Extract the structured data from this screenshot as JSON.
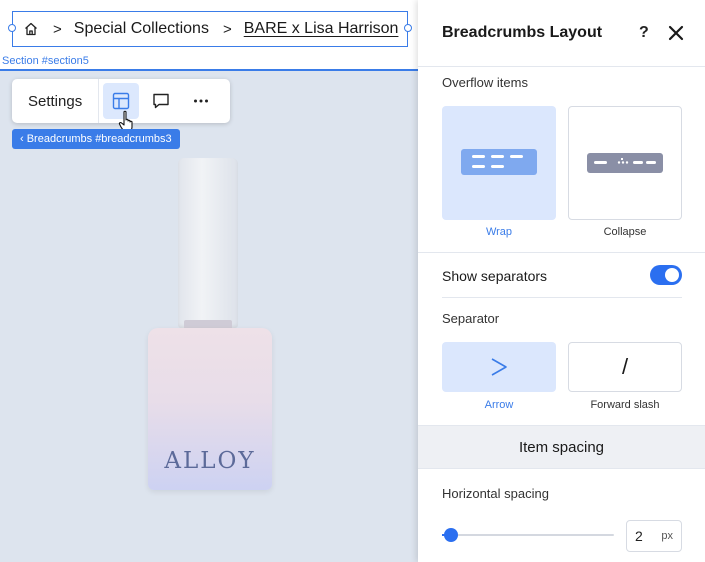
{
  "canvas": {
    "section_label": "Section #section5",
    "breadcrumbs": {
      "separator": ">",
      "items": [
        "Special Collections",
        "BARE x Lisa Harrison"
      ],
      "home_icon": "home-icon"
    },
    "toolbar": {
      "settings_label": "Settings",
      "layout_icon": "layout-icon",
      "comment_icon": "comment-icon",
      "more_icon": "more-horizontal-icon"
    },
    "element_chip": "‹ Breadcrumbs #breadcrumbs3",
    "product_brand": "ALLOY"
  },
  "panel": {
    "title": "Breadcrumbs Layout",
    "help": "?",
    "overflow_items": {
      "label": "Overflow items",
      "options": [
        {
          "label": "Wrap",
          "selected": true
        },
        {
          "label": "Collapse",
          "selected": false
        }
      ]
    },
    "show_separators": {
      "label": "Show separators",
      "on": true
    },
    "separator": {
      "label": "Separator",
      "options": [
        {
          "label": "Arrow",
          "glyph": ">",
          "selected": true
        },
        {
          "label": "Forward slash",
          "glyph": "/",
          "selected": false
        }
      ]
    },
    "item_spacing_section": "Item spacing",
    "horizontal_spacing": {
      "label": "Horizontal spacing",
      "value": "2",
      "unit": "px",
      "level": 0.05
    }
  },
  "colors": {
    "accent": "#3a7ce8",
    "toggle_on": "#2b6ff0",
    "canvas_bg": "#dde4ee"
  }
}
